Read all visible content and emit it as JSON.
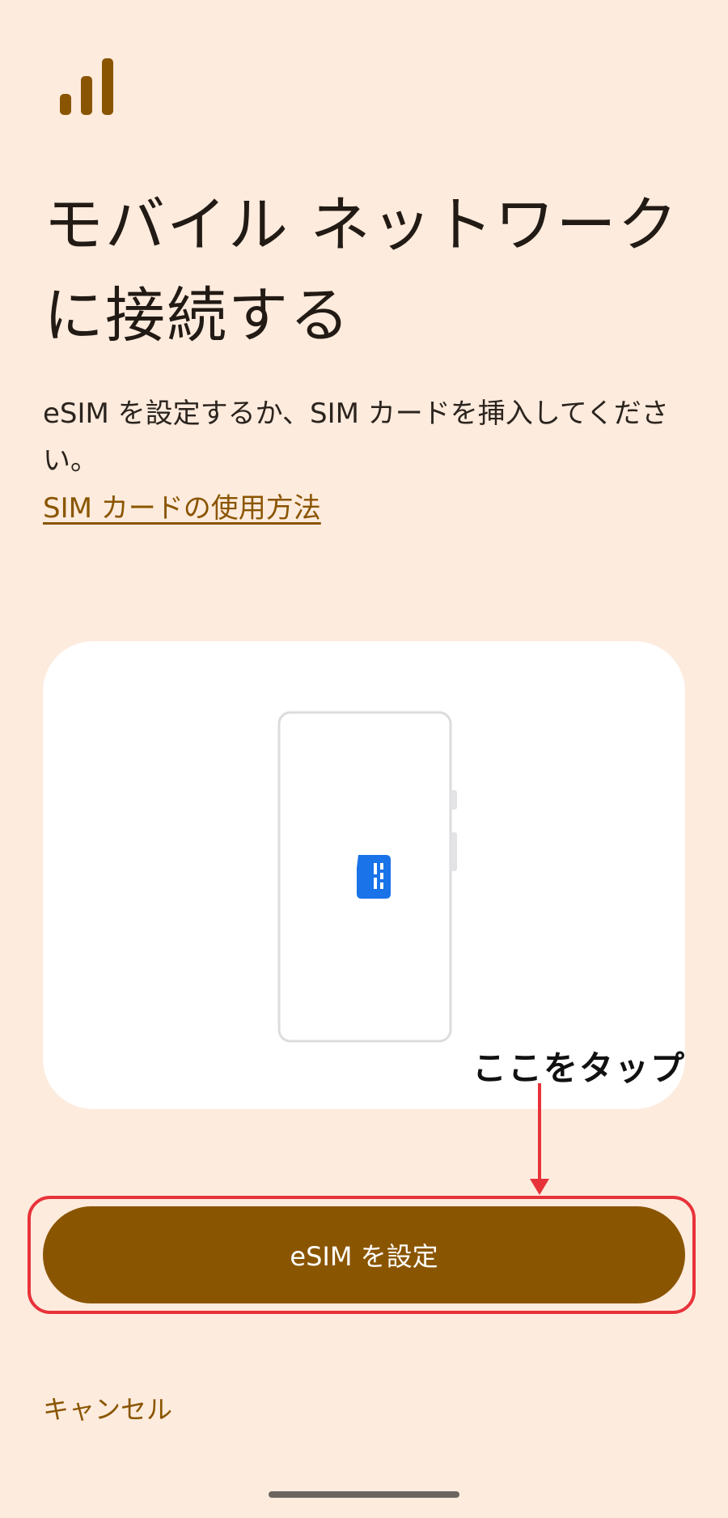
{
  "header": {
    "icon": "signal-bars-icon",
    "title": "モバイル ネットワークに接続する"
  },
  "body": {
    "description": "eSIM を設定するか、SIM カードを挿入してください。",
    "help_link": "SIM カードの使用方法"
  },
  "illustration": {
    "icon": "sim-card-icon",
    "sim_color": "#1a73e8"
  },
  "annotation": {
    "label": "ここをタップ",
    "color": "#e8323a"
  },
  "actions": {
    "primary_label": "eSIM を設定",
    "cancel_label": "キャンセル"
  },
  "colors": {
    "background": "#fdebdd",
    "accent": "#8a5500"
  }
}
